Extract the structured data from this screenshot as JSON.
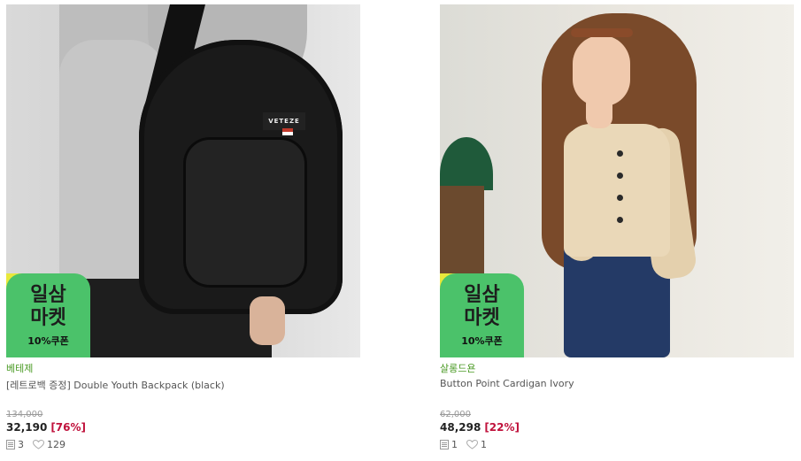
{
  "products": [
    {
      "brand": "베테제",
      "title": "[레트로백 증정] Double Youth Backpack (black)",
      "original_price": "134,000",
      "price": "32,190",
      "discount": "[76%]",
      "reviews": "3",
      "likes": "129",
      "image_icon": "backpack-photo",
      "logo_text": "VETEZE",
      "badge": {
        "line1": "일삼",
        "line2": "마켓",
        "line3": "10%쿠폰"
      }
    },
    {
      "brand": "살롱드욘",
      "title": "Button Point Cardigan Ivory",
      "original_price": "62,000",
      "price": "48,298",
      "discount": "[22%]",
      "reviews": "1",
      "likes": "1",
      "image_icon": "cardigan-photo",
      "badge": {
        "line1": "일삼",
        "line2": "마켓",
        "line3": "10%쿠폰"
      }
    }
  ],
  "colors": {
    "brand_green": "#4a9a24",
    "discount_red": "#c0123c",
    "badge_green": "#4bc26a",
    "badge_yellow": "#e8e83b"
  }
}
